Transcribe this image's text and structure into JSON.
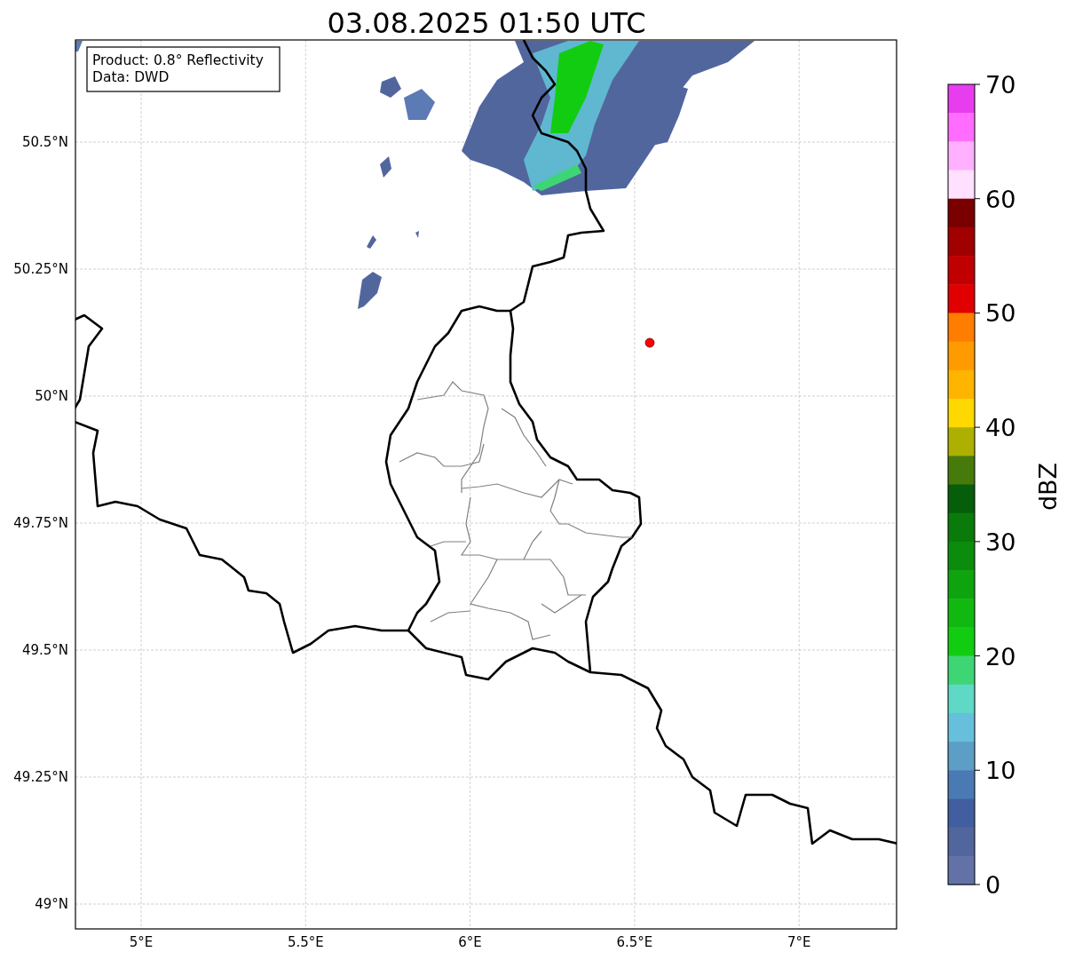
{
  "title": "03.08.2025 01:50 UTC",
  "info_box": {
    "lines": [
      "Product: 0.8° Reflectivity",
      "Data: DWD"
    ]
  },
  "map": {
    "lat_ticks": [
      "50.5°N",
      "50.25°N",
      "50°N",
      "49.75°N",
      "49.5°N",
      "49.25°N",
      "49°N"
    ],
    "lon_ticks": [
      "5°E",
      "5.5°E",
      "6°E",
      "6.5°E",
      "7°E"
    ]
  },
  "colorbar": {
    "label": "dBZ",
    "ticks": [
      "70",
      "60",
      "50",
      "40",
      "30",
      "20",
      "10",
      "0"
    ],
    "segments": [
      {
        "color": "#e83cef"
      },
      {
        "color": "#ff6cff"
      },
      {
        "color": "#ffb0ff"
      },
      {
        "color": "#ffe0ff"
      },
      {
        "color": "#7a0000"
      },
      {
        "color": "#a00000"
      },
      {
        "color": "#c00000"
      },
      {
        "color": "#e00000"
      },
      {
        "color": "#ff7d00"
      },
      {
        "color": "#ff9a00"
      },
      {
        "color": "#ffb400"
      },
      {
        "color": "#ffd800"
      },
      {
        "color": "#adb000"
      },
      {
        "color": "#467a0a"
      },
      {
        "color": "#065e0a"
      },
      {
        "color": "#0a7a0a"
      },
      {
        "color": "#0c8c0c"
      },
      {
        "color": "#0ea40e"
      },
      {
        "color": "#10b810"
      },
      {
        "color": "#12cc12"
      },
      {
        "color": "#3ed674"
      },
      {
        "color": "#5fd8c6"
      },
      {
        "color": "#66c0dc"
      },
      {
        "color": "#5c9ec6"
      },
      {
        "color": "#4a7ab3"
      },
      {
        "color": "#415ea1"
      },
      {
        "color": "#52669e"
      },
      {
        "color": "#6272a6"
      }
    ]
  }
}
